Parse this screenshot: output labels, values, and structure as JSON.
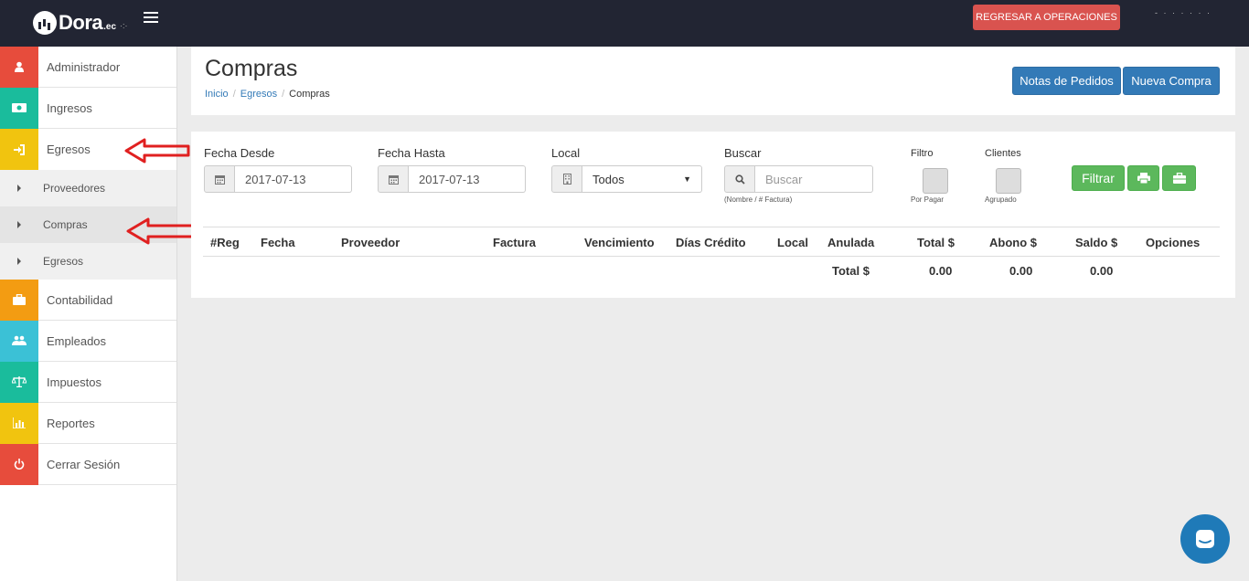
{
  "app": {
    "logo_text": "Dora",
    "logo_suffix": ".ec",
    "logo_dots": "·:·",
    "back_button": "REGRESAR A OPERACIONES",
    "user_info": "- · · · · · ·"
  },
  "sidebar": {
    "items": [
      {
        "label": "Administrador",
        "icon": "user-icon",
        "color": "#e74c3c"
      },
      {
        "label": "Ingresos",
        "icon": "money-icon",
        "color": "#1abc9c"
      },
      {
        "label": "Egresos",
        "icon": "sign-in-icon",
        "color": "#f1c40f"
      },
      {
        "label": "Contabilidad",
        "icon": "briefcase-icon",
        "color": "#f39c12"
      },
      {
        "label": "Empleados",
        "icon": "users-icon",
        "color": "#3bc1d6"
      },
      {
        "label": "Impuestos",
        "icon": "balance-scale-icon",
        "color": "#1abc9c"
      },
      {
        "label": "Reportes",
        "icon": "bar-chart-icon",
        "color": "#f1c40f"
      },
      {
        "label": "Cerrar Sesión",
        "icon": "power-icon",
        "color": "#e74c3c"
      }
    ],
    "submenu": [
      {
        "label": "Proveedores"
      },
      {
        "label": "Compras"
      },
      {
        "label": "Egresos"
      }
    ]
  },
  "header": {
    "title": "Compras",
    "breadcrumb": [
      "Inicio",
      "Egresos",
      "Compras"
    ],
    "notas_button": "Notas de Pedidos",
    "nueva_button": "Nueva Compra"
  },
  "filters": {
    "fecha_desde_label": "Fecha Desde",
    "fecha_desde_value": "2017-07-13",
    "fecha_hasta_label": "Fecha Hasta",
    "fecha_hasta_value": "2017-07-13",
    "local_label": "Local",
    "local_value": "Todos",
    "buscar_label": "Buscar",
    "buscar_placeholder": "Buscar",
    "buscar_hint": "(Nombre / # Factura)",
    "filtro_label": "Filtro",
    "filtro_hint": "Por Pagar",
    "clientes_label": "Clientes",
    "clientes_hint": "Agrupado",
    "filtrar_button": "Filtrar"
  },
  "table": {
    "columns": [
      "#Reg",
      "Fecha",
      "Proveedor",
      "Factura",
      "Vencimiento",
      "Días Crédito",
      "Local",
      "Anulada",
      "Total $",
      "Abono $",
      "Saldo $",
      "Opciones"
    ],
    "footer": {
      "label": "Total $",
      "total": "0.00",
      "abono": "0.00",
      "saldo": "0.00"
    }
  },
  "colors": {
    "topbar": "#222533",
    "primary": "#337ab7",
    "success": "#5cb85c",
    "danger": "#d9534f",
    "annotation_arrow": "#e02020"
  }
}
